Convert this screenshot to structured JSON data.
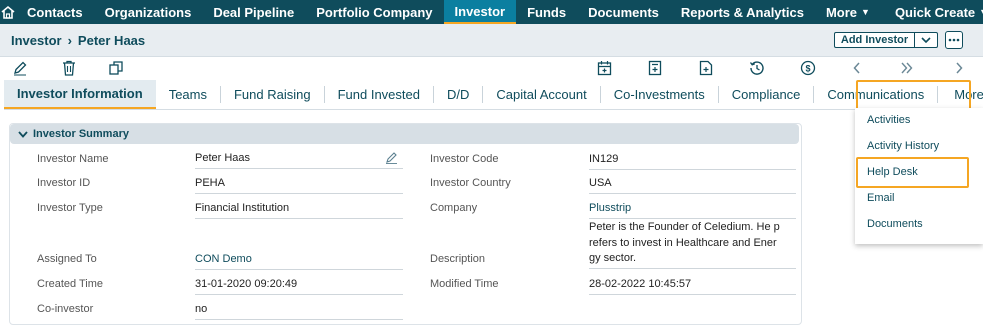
{
  "nav": {
    "items": [
      "Contacts",
      "Organizations",
      "Deal Pipeline",
      "Portfolio Company",
      "Investor",
      "Funds",
      "Documents",
      "Reports & Analytics",
      "More",
      "Quick Create"
    ],
    "active": "Investor",
    "accent": "#f5a623",
    "bar_color": "#0f4c5c"
  },
  "breadcrumb": {
    "module": "Investor",
    "record": "Peter Haas"
  },
  "header": {
    "add_button": "Add Investor"
  },
  "tabs": [
    "Investor Information",
    "Teams",
    "Fund Raising",
    "Fund Invested",
    "D/D",
    "Capital Account",
    "Co-Investments",
    "Compliance",
    "Communications",
    "More Information"
  ],
  "more_menu": [
    "Activities",
    "Activity History",
    "Help Desk",
    "Email",
    "Documents"
  ],
  "summary": {
    "title": "Investor Summary",
    "fields": {
      "investor_name": {
        "label": "Investor Name",
        "value": "Peter Haas"
      },
      "investor_code": {
        "label": "Investor Code",
        "value": "IN129"
      },
      "investor_id": {
        "label": "Investor ID",
        "value": "PEHA"
      },
      "investor_country": {
        "label": "Investor Country",
        "value": "USA"
      },
      "investor_type": {
        "label": "Investor Type",
        "value": "Financial Institution"
      },
      "company": {
        "label": "Company",
        "value": "Plusstrip"
      },
      "assigned_to": {
        "label": "Assigned To",
        "value": "CON Demo"
      },
      "description": {
        "label": "Description",
        "lines": [
          "Peter is the Founder of Celedium. He p",
          "refers to invest in Healthcare and Ener",
          "gy sector."
        ]
      },
      "created_time": {
        "label": "Created Time",
        "value": "31-01-2020 09:20:49"
      },
      "modified_time": {
        "label": "Modified Time",
        "value": "28-02-2022 10:45:57"
      },
      "co_investor": {
        "label": "Co-investor",
        "value": "no"
      }
    }
  }
}
